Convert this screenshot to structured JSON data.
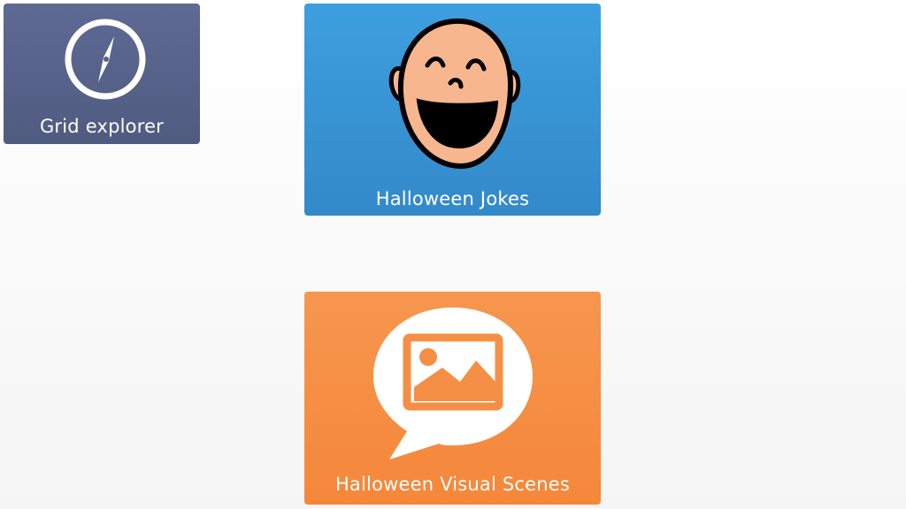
{
  "tiles": {
    "grid_explorer": {
      "label": "Grid explorer",
      "icon": "compass-icon",
      "color": "#5a6690"
    },
    "halloween_jokes": {
      "label": "Halloween Jokes",
      "icon": "laughing-face-icon",
      "color": "#3894d6"
    },
    "halloween_visual_scenes": {
      "label": "Halloween Visual Scenes",
      "icon": "speech-bubble-image-icon",
      "color": "#f58f45"
    }
  }
}
